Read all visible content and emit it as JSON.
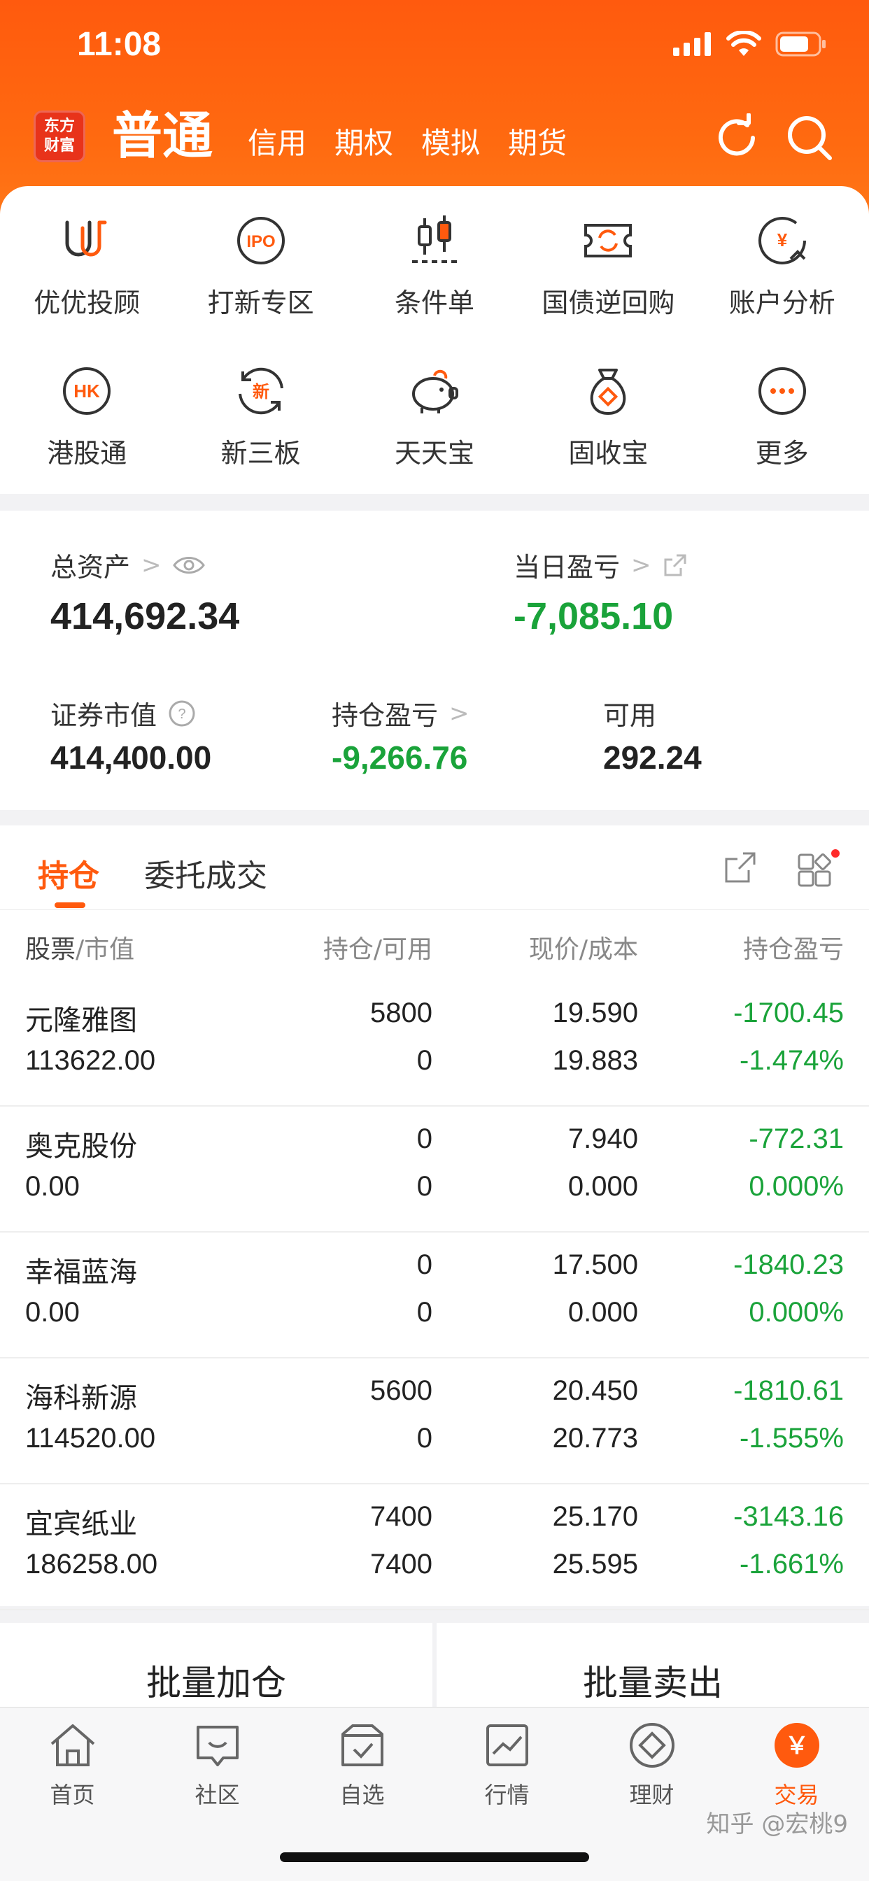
{
  "status": {
    "time": "11:08"
  },
  "header": {
    "logo_line1": "东方",
    "logo_line2": "财富",
    "tabs": [
      {
        "label": "普通"
      },
      {
        "label": "信用"
      },
      {
        "label": "期权"
      },
      {
        "label": "模拟"
      },
      {
        "label": "期货"
      }
    ],
    "refresh_icon": "refresh-icon",
    "search_icon": "search-icon"
  },
  "grid": [
    {
      "label": "优优投顾",
      "icon": "uu-advisor-icon"
    },
    {
      "label": "打新专区",
      "icon": "ipo-icon",
      "glyph": "IPO"
    },
    {
      "label": "条件单",
      "icon": "candlestick-icon"
    },
    {
      "label": "国债逆回购",
      "icon": "bond-repo-icon"
    },
    {
      "label": "账户分析",
      "icon": "account-analysis-icon",
      "glyph": "¥"
    },
    {
      "label": "港股通",
      "icon": "hk-connect-icon",
      "glyph": "HK"
    },
    {
      "label": "新三板",
      "icon": "new-third-board-icon",
      "glyph": "新"
    },
    {
      "label": "天天宝",
      "icon": "piggy-bank-icon"
    },
    {
      "label": "固收宝",
      "icon": "money-bag-icon"
    },
    {
      "label": "更多",
      "icon": "more-icon"
    }
  ],
  "assets": {
    "total_label": "总资产",
    "total_value": "414,692.34",
    "daily_label": "当日盈亏",
    "daily_value": "-7,085.10",
    "market_label": "证券市值",
    "market_value": "414,400.00",
    "holding_label": "持仓盈亏",
    "holding_value": "-9,266.76",
    "available_label": "可用",
    "available_value": "292.24"
  },
  "positions": {
    "tabs": [
      {
        "label": "持仓"
      },
      {
        "label": "委托成交"
      }
    ],
    "headers": {
      "stock_a": "股票",
      "stock_b": "/市值",
      "qty_a": "持仓",
      "qty_b": "/可用",
      "price_a": "现价",
      "price_b": "/成本",
      "pl": "持仓盈亏"
    },
    "rows": [
      {
        "name": "元隆雅图",
        "mv": "113622.00",
        "qty": "5800",
        "avail": "0",
        "price": "19.590",
        "cost": "19.883",
        "pl": "-1700.45",
        "pct": "-1.474%"
      },
      {
        "name": "奥克股份",
        "mv": "0.00",
        "qty": "0",
        "avail": "0",
        "price": "7.940",
        "cost": "0.000",
        "pl": "-772.31",
        "pct": "0.000%"
      },
      {
        "name": "幸福蓝海",
        "mv": "0.00",
        "qty": "0",
        "avail": "0",
        "price": "17.500",
        "cost": "0.000",
        "pl": "-1840.23",
        "pct": "0.000%"
      },
      {
        "name": "海科新源",
        "mv": "114520.00",
        "qty": "5600",
        "avail": "0",
        "price": "20.450",
        "cost": "20.773",
        "pl": "-1810.61",
        "pct": "-1.555%"
      },
      {
        "name": "宜宾纸业",
        "mv": "186258.00",
        "qty": "7400",
        "avail": "7400",
        "price": "25.170",
        "cost": "25.595",
        "pl": "-3143.16",
        "pct": "-1.661%"
      }
    ]
  },
  "batch": {
    "add": "批量加仓",
    "sell": "批量卖出"
  },
  "nav": [
    {
      "label": "首页",
      "icon": "home-icon"
    },
    {
      "label": "社区",
      "icon": "community-icon"
    },
    {
      "label": "自选",
      "icon": "watchlist-icon"
    },
    {
      "label": "行情",
      "icon": "market-icon"
    },
    {
      "label": "理财",
      "icon": "wealth-icon"
    },
    {
      "label": "交易",
      "icon": "trade-icon",
      "glyph": "￥"
    }
  ],
  "watermark": "知乎 @宏桃9",
  "colors": {
    "accent": "#ff5a0e",
    "loss": "#1aa33a"
  }
}
